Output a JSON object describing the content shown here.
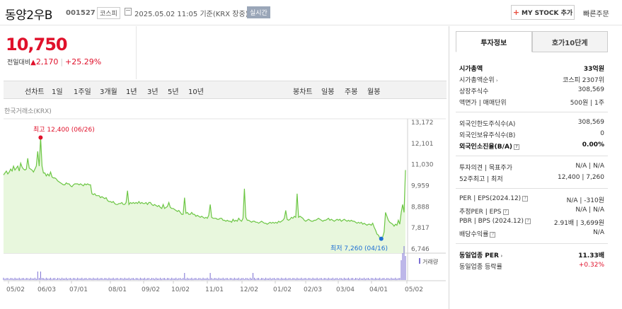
{
  "header": {
    "stock_name": "동양2우B",
    "stock_code": "001527",
    "market": "코스피",
    "datetime": "2025.05.02 11:05",
    "basis": "기준(KRX 장중)",
    "realtime": "실시간",
    "my_stock_btn": "MY STOCK 추가",
    "quick_order": "빠른주문"
  },
  "quote": {
    "price": "10,750",
    "change_label": "전일대비",
    "change": "2,170",
    "change_pct": "+25.29%",
    "up_color": "#e0112b"
  },
  "tabs": {
    "line_chart": "선차트",
    "periods": [
      "1일",
      "1주일",
      "3개월",
      "1년",
      "3년",
      "5년",
      "10년"
    ],
    "active_period": "1년",
    "candle_chart": "봉차트",
    "candles": [
      "일봉",
      "주봉",
      "월봉"
    ]
  },
  "chart": {
    "source": "한국거래소(KRX)",
    "high_label": "최고 12,400 (06/26)",
    "low_label": "최저 7,260 (04/16)",
    "volume_label": "거래량",
    "y_ticks": [
      "13,172",
      "12,101",
      "11,030",
      "9,959",
      "8,888",
      "7,817",
      "6,746"
    ],
    "x_ticks": [
      "05/02",
      "06/03",
      "07/01",
      "08/01",
      "09/02",
      "10/02",
      "11/01",
      "12/02",
      "01/02",
      "02/03",
      "03/04",
      "04/01",
      "05/02"
    ],
    "line_color": "#6cc644",
    "fill_color": "#e8f7dd"
  },
  "chart_data": {
    "type": "area",
    "ylim": [
      6746,
      13172
    ],
    "high": {
      "value": 12400,
      "date": "06/26"
    },
    "low": {
      "value": 7260,
      "date": "04/16"
    },
    "series": [
      {
        "values": [
          10500,
          10600,
          10700,
          10550,
          10650,
          10800,
          10700,
          10950,
          10750,
          10850,
          10950,
          10700,
          11100,
          10900,
          10800,
          10750,
          10800,
          11350,
          10850,
          10800,
          10750,
          10650,
          10800,
          10950,
          11700,
          10950,
          12400,
          10950,
          10600,
          10600,
          10450,
          10550,
          10450,
          10650,
          10400,
          10350,
          10350,
          10300,
          10200,
          10150,
          10100,
          10050,
          10000,
          10000,
          10100,
          10050,
          10050,
          9950,
          9900,
          10000,
          10050,
          10050,
          10050,
          10000,
          10050,
          10000,
          9950,
          10050,
          10000,
          10050,
          10000,
          10000,
          9550,
          9500,
          9550,
          9450,
          9450,
          9450,
          9350,
          9400,
          9350,
          9300,
          9350,
          9200,
          9150,
          9150,
          9100,
          9150,
          9050,
          9000,
          9000,
          9050,
          9050,
          9100,
          9000,
          9000,
          9100,
          9700,
          9000,
          9100,
          9050,
          9100,
          9050,
          9100,
          9050,
          9150,
          9050,
          9100,
          9050,
          9050,
          9100,
          9000,
          9100,
          9100,
          9000,
          8950,
          9000,
          8950,
          8900,
          8950,
          8850,
          8800,
          9000,
          8800,
          8850,
          8900,
          9100,
          8850,
          8800,
          8800,
          8750,
          8700,
          8650,
          8700,
          8600,
          8500,
          8500,
          9350,
          8550,
          8600,
          8500,
          8500,
          8600,
          8500,
          8500,
          8400,
          8450,
          8400,
          8350,
          8400,
          8350,
          8300,
          8350,
          8300,
          8450,
          9000,
          8350,
          8300,
          8300,
          8300,
          8250,
          8250,
          8300,
          8300,
          8200,
          8200,
          8150,
          8200,
          8150,
          8150,
          8100,
          8250,
          8150,
          8200,
          8150,
          8300,
          8200,
          8150,
          8300,
          9800,
          8350,
          8200,
          8200,
          8150,
          8100,
          8150,
          8150,
          8100,
          8100,
          8050,
          8100,
          8150,
          8100,
          8050,
          8050,
          8000,
          8050,
          8100,
          8050,
          8100,
          8050,
          8100,
          8050,
          8150,
          8100,
          8150,
          8200,
          8300,
          8700,
          8250,
          8200,
          8250,
          8350,
          8300,
          8400,
          8350,
          9550,
          8350,
          8400,
          8350,
          8300,
          8200,
          8150,
          8200,
          8250,
          8200,
          8150,
          8150,
          8200,
          8200,
          8250,
          8300,
          8250,
          8200,
          8150,
          8200,
          8200,
          8250,
          8300,
          8200,
          8250,
          8200,
          8150,
          8200,
          8250,
          8200,
          8250,
          8150,
          8200,
          8250,
          8200,
          8150,
          8200,
          8150,
          8200,
          8150,
          8150,
          8100,
          8050,
          8100,
          8050,
          8100,
          8000,
          8050,
          8000,
          7950,
          8000,
          8000,
          7950,
          8050,
          7850,
          7700,
          7500,
          7450,
          7300,
          7260,
          7350,
          7600,
          8600,
          8400,
          8200,
          8100,
          8050,
          8000,
          7900,
          8000,
          7950,
          8200,
          8000,
          8600,
          9000,
          8600,
          10750
        ]
      }
    ]
  }
}
